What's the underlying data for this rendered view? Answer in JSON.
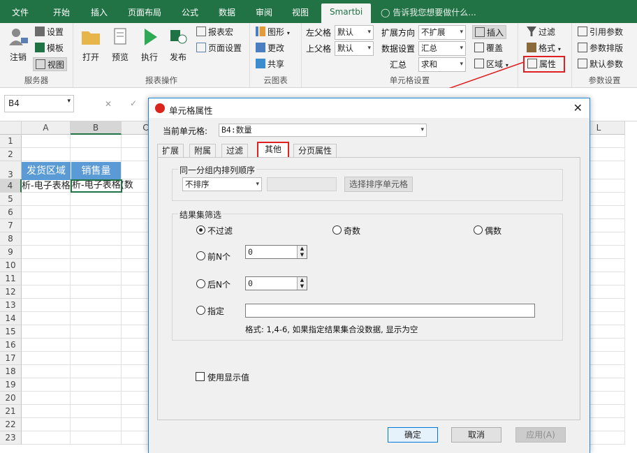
{
  "menu": {
    "tabs": [
      "文件",
      "开始",
      "插入",
      "页面布局",
      "公式",
      "数据",
      "审阅",
      "视图",
      "Smartbi"
    ],
    "tell_me": "告诉我您想要做什么..."
  },
  "ribbon": {
    "server": {
      "logout": "注销",
      "settings": "设置",
      "template": "模板",
      "view": "视图",
      "label": "服务器"
    },
    "report": {
      "open": "打开",
      "preview": "预览",
      "run": "执行",
      "publish": "发布",
      "macro": "报表宏",
      "page_setup": "页面设置",
      "label": "报表操作"
    },
    "cloud": {
      "graph": "图形",
      "change": "更改",
      "share": "共享",
      "label": "云图表"
    },
    "cell": {
      "left_parent": "左父格",
      "left_parent_val": "默认",
      "up_parent": "上父格",
      "up_parent_val": "默认",
      "expand_dir": "扩展方向",
      "expand_dir_val": "不扩展",
      "data_setting": "数据设置",
      "data_setting_val": "汇总",
      "summary": "汇总",
      "summary_val": "求和",
      "insert": "插入",
      "cover": "覆盖",
      "region": "区域",
      "label": "单元格设置"
    },
    "filter": {
      "filter": "过滤",
      "format": "格式",
      "property": "属性"
    },
    "params": {
      "ref": "引用参数",
      "layout": "参数排版",
      "default": "默认参数",
      "label": "参数设置"
    }
  },
  "formula_bar": {
    "name_box": "B4",
    "cancel": "✕",
    "confirm": "✓"
  },
  "sheet": {
    "columns": [
      "A",
      "B",
      "C",
      "L"
    ],
    "rows": [
      "1",
      "2",
      "3",
      "4",
      "5",
      "6",
      "7",
      "8",
      "9",
      "10",
      "11",
      "12",
      "13",
      "14",
      "15",
      "16",
      "17",
      "18",
      "19",
      "20",
      "21",
      "22",
      "23"
    ],
    "header_a3": "发货区域",
    "header_b3": "销售量",
    "a4": "析-电子表格",
    "b4": "析-电子表格(数"
  },
  "dialog": {
    "title": "单元格属性",
    "current_cell_label": "当前单元格:",
    "current_cell_value": "B4:数量",
    "tabs": [
      "扩展",
      "附属",
      "过滤",
      "其他",
      "分页属性"
    ],
    "sort_group": "同一分组内排列顺序",
    "sort_value": "不排序",
    "sort_button": "选择排序单元格",
    "filter_group": "结果集筛选",
    "no_filter": "不过滤",
    "odd": "奇数",
    "even": "偶数",
    "first_n": "前N个",
    "first_n_val": "0",
    "last_n": "后N个",
    "last_n_val": "0",
    "specify": "指定",
    "specify_val": "",
    "format_hint": "格式: 1,4-6, 如果指定结果集合没数据, 显示为空",
    "use_display": "使用显示值",
    "ok": "确定",
    "cancel": "取消",
    "apply": "应用(A)"
  }
}
